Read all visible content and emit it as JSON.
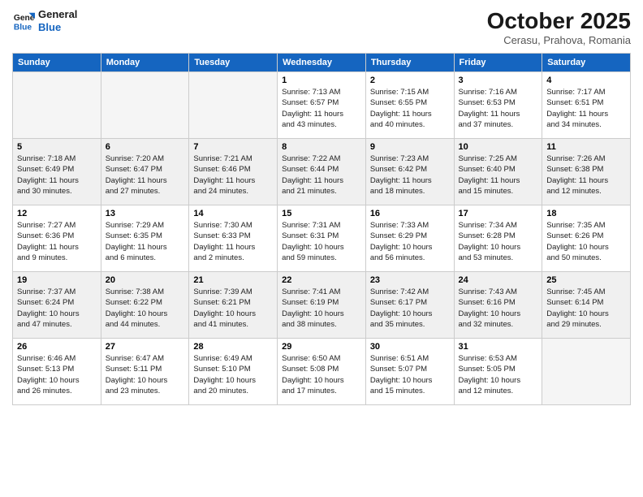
{
  "logo": {
    "line1": "General",
    "line2": "Blue"
  },
  "title": "October 2025",
  "subtitle": "Cerasu, Prahova, Romania",
  "weekdays": [
    "Sunday",
    "Monday",
    "Tuesday",
    "Wednesday",
    "Thursday",
    "Friday",
    "Saturday"
  ],
  "weeks": [
    [
      {
        "day": "",
        "info": ""
      },
      {
        "day": "",
        "info": ""
      },
      {
        "day": "",
        "info": ""
      },
      {
        "day": "1",
        "info": "Sunrise: 7:13 AM\nSunset: 6:57 PM\nDaylight: 11 hours\nand 43 minutes."
      },
      {
        "day": "2",
        "info": "Sunrise: 7:15 AM\nSunset: 6:55 PM\nDaylight: 11 hours\nand 40 minutes."
      },
      {
        "day": "3",
        "info": "Sunrise: 7:16 AM\nSunset: 6:53 PM\nDaylight: 11 hours\nand 37 minutes."
      },
      {
        "day": "4",
        "info": "Sunrise: 7:17 AM\nSunset: 6:51 PM\nDaylight: 11 hours\nand 34 minutes."
      }
    ],
    [
      {
        "day": "5",
        "info": "Sunrise: 7:18 AM\nSunset: 6:49 PM\nDaylight: 11 hours\nand 30 minutes."
      },
      {
        "day": "6",
        "info": "Sunrise: 7:20 AM\nSunset: 6:47 PM\nDaylight: 11 hours\nand 27 minutes."
      },
      {
        "day": "7",
        "info": "Sunrise: 7:21 AM\nSunset: 6:46 PM\nDaylight: 11 hours\nand 24 minutes."
      },
      {
        "day": "8",
        "info": "Sunrise: 7:22 AM\nSunset: 6:44 PM\nDaylight: 11 hours\nand 21 minutes."
      },
      {
        "day": "9",
        "info": "Sunrise: 7:23 AM\nSunset: 6:42 PM\nDaylight: 11 hours\nand 18 minutes."
      },
      {
        "day": "10",
        "info": "Sunrise: 7:25 AM\nSunset: 6:40 PM\nDaylight: 11 hours\nand 15 minutes."
      },
      {
        "day": "11",
        "info": "Sunrise: 7:26 AM\nSunset: 6:38 PM\nDaylight: 11 hours\nand 12 minutes."
      }
    ],
    [
      {
        "day": "12",
        "info": "Sunrise: 7:27 AM\nSunset: 6:36 PM\nDaylight: 11 hours\nand 9 minutes."
      },
      {
        "day": "13",
        "info": "Sunrise: 7:29 AM\nSunset: 6:35 PM\nDaylight: 11 hours\nand 6 minutes."
      },
      {
        "day": "14",
        "info": "Sunrise: 7:30 AM\nSunset: 6:33 PM\nDaylight: 11 hours\nand 2 minutes."
      },
      {
        "day": "15",
        "info": "Sunrise: 7:31 AM\nSunset: 6:31 PM\nDaylight: 10 hours\nand 59 minutes."
      },
      {
        "day": "16",
        "info": "Sunrise: 7:33 AM\nSunset: 6:29 PM\nDaylight: 10 hours\nand 56 minutes."
      },
      {
        "day": "17",
        "info": "Sunrise: 7:34 AM\nSunset: 6:28 PM\nDaylight: 10 hours\nand 53 minutes."
      },
      {
        "day": "18",
        "info": "Sunrise: 7:35 AM\nSunset: 6:26 PM\nDaylight: 10 hours\nand 50 minutes."
      }
    ],
    [
      {
        "day": "19",
        "info": "Sunrise: 7:37 AM\nSunset: 6:24 PM\nDaylight: 10 hours\nand 47 minutes."
      },
      {
        "day": "20",
        "info": "Sunrise: 7:38 AM\nSunset: 6:22 PM\nDaylight: 10 hours\nand 44 minutes."
      },
      {
        "day": "21",
        "info": "Sunrise: 7:39 AM\nSunset: 6:21 PM\nDaylight: 10 hours\nand 41 minutes."
      },
      {
        "day": "22",
        "info": "Sunrise: 7:41 AM\nSunset: 6:19 PM\nDaylight: 10 hours\nand 38 minutes."
      },
      {
        "day": "23",
        "info": "Sunrise: 7:42 AM\nSunset: 6:17 PM\nDaylight: 10 hours\nand 35 minutes."
      },
      {
        "day": "24",
        "info": "Sunrise: 7:43 AM\nSunset: 6:16 PM\nDaylight: 10 hours\nand 32 minutes."
      },
      {
        "day": "25",
        "info": "Sunrise: 7:45 AM\nSunset: 6:14 PM\nDaylight: 10 hours\nand 29 minutes."
      }
    ],
    [
      {
        "day": "26",
        "info": "Sunrise: 6:46 AM\nSunset: 5:13 PM\nDaylight: 10 hours\nand 26 minutes."
      },
      {
        "day": "27",
        "info": "Sunrise: 6:47 AM\nSunset: 5:11 PM\nDaylight: 10 hours\nand 23 minutes."
      },
      {
        "day": "28",
        "info": "Sunrise: 6:49 AM\nSunset: 5:10 PM\nDaylight: 10 hours\nand 20 minutes."
      },
      {
        "day": "29",
        "info": "Sunrise: 6:50 AM\nSunset: 5:08 PM\nDaylight: 10 hours\nand 17 minutes."
      },
      {
        "day": "30",
        "info": "Sunrise: 6:51 AM\nSunset: 5:07 PM\nDaylight: 10 hours\nand 15 minutes."
      },
      {
        "day": "31",
        "info": "Sunrise: 6:53 AM\nSunset: 5:05 PM\nDaylight: 10 hours\nand 12 minutes."
      },
      {
        "day": "",
        "info": ""
      }
    ]
  ]
}
